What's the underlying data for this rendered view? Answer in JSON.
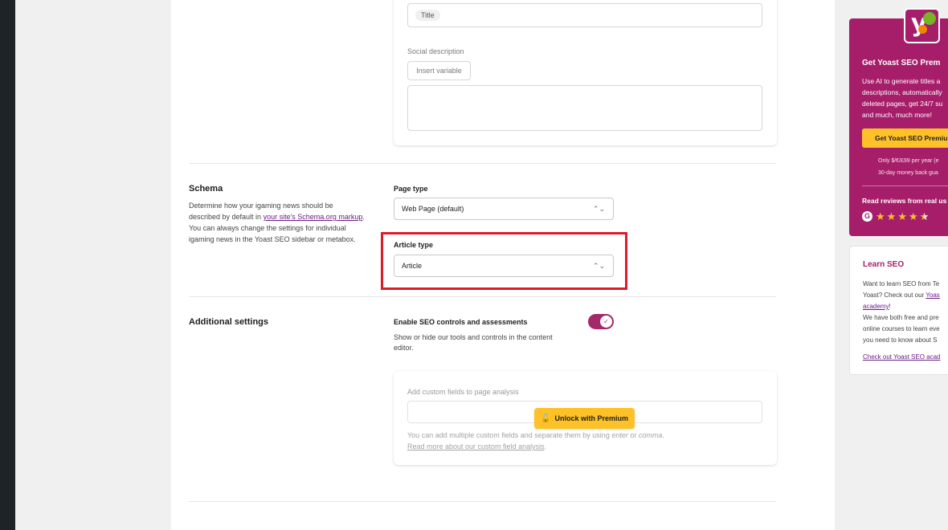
{
  "social": {
    "title_chip": "Title",
    "social_description_label": "Social description",
    "insert_variable_button": "Insert variable"
  },
  "schema": {
    "title": "Schema",
    "desc_1": "Determine how your igaming news should be described by default in ",
    "desc_link": "your site's Schema.org markup",
    "desc_2": ". You can always change the settings for individual igaming news in the Yoast SEO sidebar or metabox.",
    "page_type_label": "Page type",
    "page_type_value": "Web Page (default)",
    "article_type_label": "Article type",
    "article_type_value": "Article"
  },
  "additional": {
    "title": "Additional settings",
    "toggle_label": "Enable SEO controls and assessments",
    "toggle_help": "Show or hide our tools and controls in the content editor.",
    "toggle_on": true,
    "custom_fields_label": "Add custom fields to page analysis",
    "custom_help_1": "You can add multiple custom fields and separate them by using ",
    "custom_help_enter": "enter",
    "custom_help_or": " or ",
    "custom_help_comma": "comma",
    "custom_help_end": ".",
    "custom_help_link": "Read more about our custom field analysis",
    "custom_help_link_end": ".",
    "unlock_button": "Unlock with Premium"
  },
  "promo": {
    "title": "Get Yoast SEO Prem",
    "body_lines": [
      "Use AI to generate titles a",
      "descriptions, automatically",
      "deleted pages, get 24/7 su",
      "and much, much more!"
    ],
    "button": "Get Yoast SEO Premiu",
    "small_1": "Only $/€/£99 per year (e",
    "small_2": "30-day money back gua",
    "reviews": "Read reviews from real us",
    "rating_stars": 4.5
  },
  "learn": {
    "title": "Learn SEO",
    "line_1": "Want to learn SEO from Te",
    "line_2_a": "Yoast? Check out our ",
    "line_2_link": "Yoas",
    "line_3_link": "academy",
    "line_3_b": "!",
    "line_4": "We have both free and pre",
    "line_5": "online courses to learn eve",
    "line_6": "you need to know about S",
    "link": "Check out Yoast SEO acad"
  },
  "colors": {
    "brand": "#a61e69",
    "accent_yellow": "#fec228",
    "highlight_red": "#dc1c2a"
  }
}
